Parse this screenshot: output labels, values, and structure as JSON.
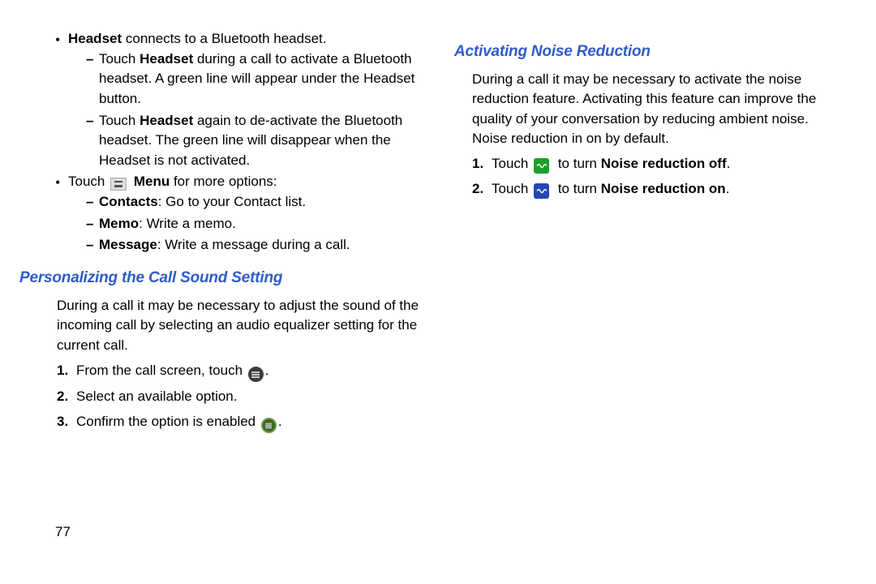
{
  "left": {
    "bullets": [
      {
        "lead_bold": "Headset",
        "tail": " connects to a Bluetooth headset.",
        "subitems": [
          {
            "prefix": "Touch ",
            "bold": "Headset",
            "suffix": " during a call to activate a Bluetooth headset. A green line will appear under the Headset button."
          },
          {
            "prefix": "Touch ",
            "bold": "Headset",
            "suffix": " again to de-activate the Bluetooth headset. The green line will disappear when the Headset is not activated."
          }
        ]
      },
      {
        "prefix": "Touch ",
        "icon_bold": "Menu",
        "suffix": " for more options:",
        "subitems": [
          {
            "bold": "Contacts",
            "suffix": ": Go to your Contact list."
          },
          {
            "bold": "Memo",
            "suffix": ": Write a memo."
          },
          {
            "bold": "Message",
            "suffix": ": Write a message during a call."
          }
        ]
      }
    ],
    "section1": {
      "heading": "Personalizing the Call Sound Setting",
      "intro": "During a call it may be necessary to adjust the sound of the incoming call by selecting an audio equalizer setting for the current call.",
      "steps": [
        {
          "num": "1.",
          "prefix": "From the call screen, touch ",
          "post": "."
        },
        {
          "num": "2.",
          "text": "Select an available option."
        },
        {
          "num": "3.",
          "prefix": "Confirm the option is enabled ",
          "post": "."
        }
      ]
    },
    "page_number": "77"
  },
  "right": {
    "section2": {
      "heading": "Activating Noise Reduction",
      "intro": "During a call it may be necessary to activate the noise reduction feature. Activating this feature can improve the quality of your conversation by reducing ambient noise. Noise reduction in on by default.",
      "steps": [
        {
          "num": "1.",
          "prefix": "Touch ",
          "bold_post": "Noise reduction off",
          "post": ".",
          "mid": " to turn "
        },
        {
          "num": "2.",
          "prefix": "Touch ",
          "bold_post": "Noise reduction on",
          "post": ".",
          "mid": " to turn "
        }
      ]
    }
  }
}
